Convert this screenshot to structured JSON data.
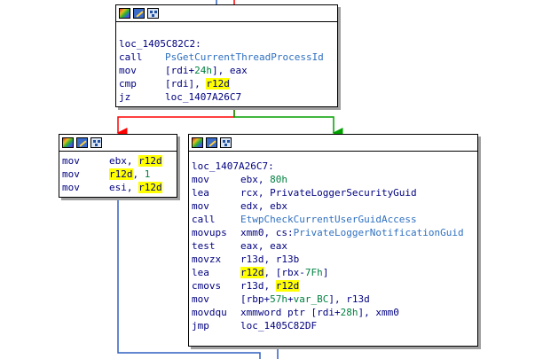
{
  "colors": {
    "edge_true": "#00a000",
    "edge_false": "#ff0000",
    "edge_normal": "#3060c0",
    "highlight": "#ffff00"
  },
  "blocks": {
    "top": {
      "label": "loc_1405C82C2:",
      "lines": [
        {
          "mn": "call",
          "parts": [
            {
              "t": "PsGetCurrentThreadProcessId",
              "c": "fn"
            }
          ]
        },
        {
          "mn": "mov",
          "parts": [
            {
              "t": "[rdi+",
              "c": "op"
            },
            {
              "t": "24h",
              "c": "num"
            },
            {
              "t": "], eax",
              "c": "op"
            }
          ]
        },
        {
          "mn": "cmp",
          "parts": [
            {
              "t": "[rdi], ",
              "c": "op"
            },
            {
              "t": "r12d",
              "c": "hl"
            }
          ]
        },
        {
          "mn": "jz",
          "parts": [
            {
              "t": "loc_1407A26C7",
              "c": "op"
            }
          ]
        }
      ]
    },
    "left": {
      "lines": [
        {
          "mn": "mov",
          "parts": [
            {
              "t": "ebx, ",
              "c": "op"
            },
            {
              "t": "r12d",
              "c": "hl"
            }
          ]
        },
        {
          "mn": "mov",
          "parts": [
            {
              "t": "r12d",
              "c": "hl"
            },
            {
              "t": ", ",
              "c": "op"
            },
            {
              "t": "1",
              "c": "num"
            }
          ]
        },
        {
          "mn": "mov",
          "parts": [
            {
              "t": "esi, ",
              "c": "op"
            },
            {
              "t": "r12d",
              "c": "hl"
            }
          ]
        }
      ]
    },
    "right": {
      "label": "loc_1407A26C7:",
      "lines": [
        {
          "mn": "mov",
          "parts": [
            {
              "t": "ebx, ",
              "c": "op"
            },
            {
              "t": "80h",
              "c": "num"
            }
          ]
        },
        {
          "mn": "lea",
          "parts": [
            {
              "t": "rcx, PrivateLoggerSecurityGuid",
              "c": "op"
            }
          ]
        },
        {
          "mn": "mov",
          "parts": [
            {
              "t": "edx, ebx",
              "c": "op"
            }
          ]
        },
        {
          "mn": "call",
          "parts": [
            {
              "t": "EtwpCheckCurrentUserGuidAccess",
              "c": "fn"
            }
          ]
        },
        {
          "mn": "movups",
          "parts": [
            {
              "t": "xmm0, cs:",
              "c": "op"
            },
            {
              "t": "PrivateLoggerNotificationGuid",
              "c": "fn"
            }
          ]
        },
        {
          "mn": "test",
          "parts": [
            {
              "t": "eax, eax",
              "c": "op"
            }
          ]
        },
        {
          "mn": "movzx",
          "parts": [
            {
              "t": "r13d, r13b",
              "c": "op"
            }
          ]
        },
        {
          "mn": "lea",
          "parts": [
            {
              "t": "r12d",
              "c": "hl"
            },
            {
              "t": ", [rbx-",
              "c": "op"
            },
            {
              "t": "7Fh",
              "c": "num"
            },
            {
              "t": "]",
              "c": "op"
            }
          ]
        },
        {
          "mn": "cmovs",
          "parts": [
            {
              "t": "r13d, ",
              "c": "op"
            },
            {
              "t": "r12d",
              "c": "hl"
            }
          ]
        },
        {
          "mn": "mov",
          "parts": [
            {
              "t": "[rbp+",
              "c": "op"
            },
            {
              "t": "57h",
              "c": "num"
            },
            {
              "t": "+",
              "c": "op"
            },
            {
              "t": "var_BC",
              "c": "num"
            },
            {
              "t": "], r13d",
              "c": "op"
            }
          ]
        },
        {
          "mn": "movdqu",
          "parts": [
            {
              "t": "xmmword ptr [rdi+",
              "c": "op"
            },
            {
              "t": "28h",
              "c": "num"
            },
            {
              "t": "], xmm0",
              "c": "op"
            }
          ]
        },
        {
          "mn": "jmp",
          "parts": [
            {
              "t": "loc_1405C82DF",
              "c": "op"
            }
          ]
        }
      ]
    }
  }
}
